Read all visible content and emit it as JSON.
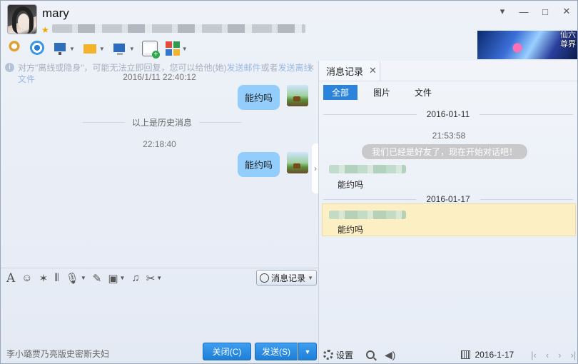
{
  "header": {
    "username": "mary",
    "window_controls": [
      "▾",
      "—",
      "□",
      "✕"
    ],
    "banner_text": "仙六\n尊界"
  },
  "toolbar": {
    "icons": [
      "mic-icon",
      "camera-icon",
      "screen-share-icon",
      "file-transfer-icon",
      "remote-desktop-icon",
      "add-chat-icon",
      "apps-icon"
    ]
  },
  "chat": {
    "notice_prefix": "对方\"离线或隐身\"，可能无法立即回复，您可以给他(她)",
    "notice_link1": "发送邮件",
    "notice_mid": "或者",
    "notice_link2": "发送离线文件",
    "timestamp1": "2016/1/11 22:40:12",
    "message1": "能约吗",
    "history_divider": "以上是历史消息",
    "timestamp2": "22:18:40",
    "message2": "能约吗"
  },
  "input": {
    "history_button": "消息记录",
    "ad_text": "李小璐贾乃亮版史密斯夫妇",
    "close_button": "关闭(C)",
    "send_button": "发送(S)",
    "send_arrow": "▼"
  },
  "record": {
    "tab_label": "消息记录",
    "filters": [
      "全部",
      "图片",
      "文件"
    ],
    "date1": "2016-01-11",
    "time1": "21:53:58",
    "system_message": "我们已经是好友了，现在开始对话吧！",
    "message1": "能约吗",
    "date2": "2016-01-17",
    "message2": "能约吗",
    "settings_label": "设置",
    "current_date": "2016-1-17",
    "nav": [
      "|‹",
      "‹",
      "›",
      "›|"
    ]
  }
}
